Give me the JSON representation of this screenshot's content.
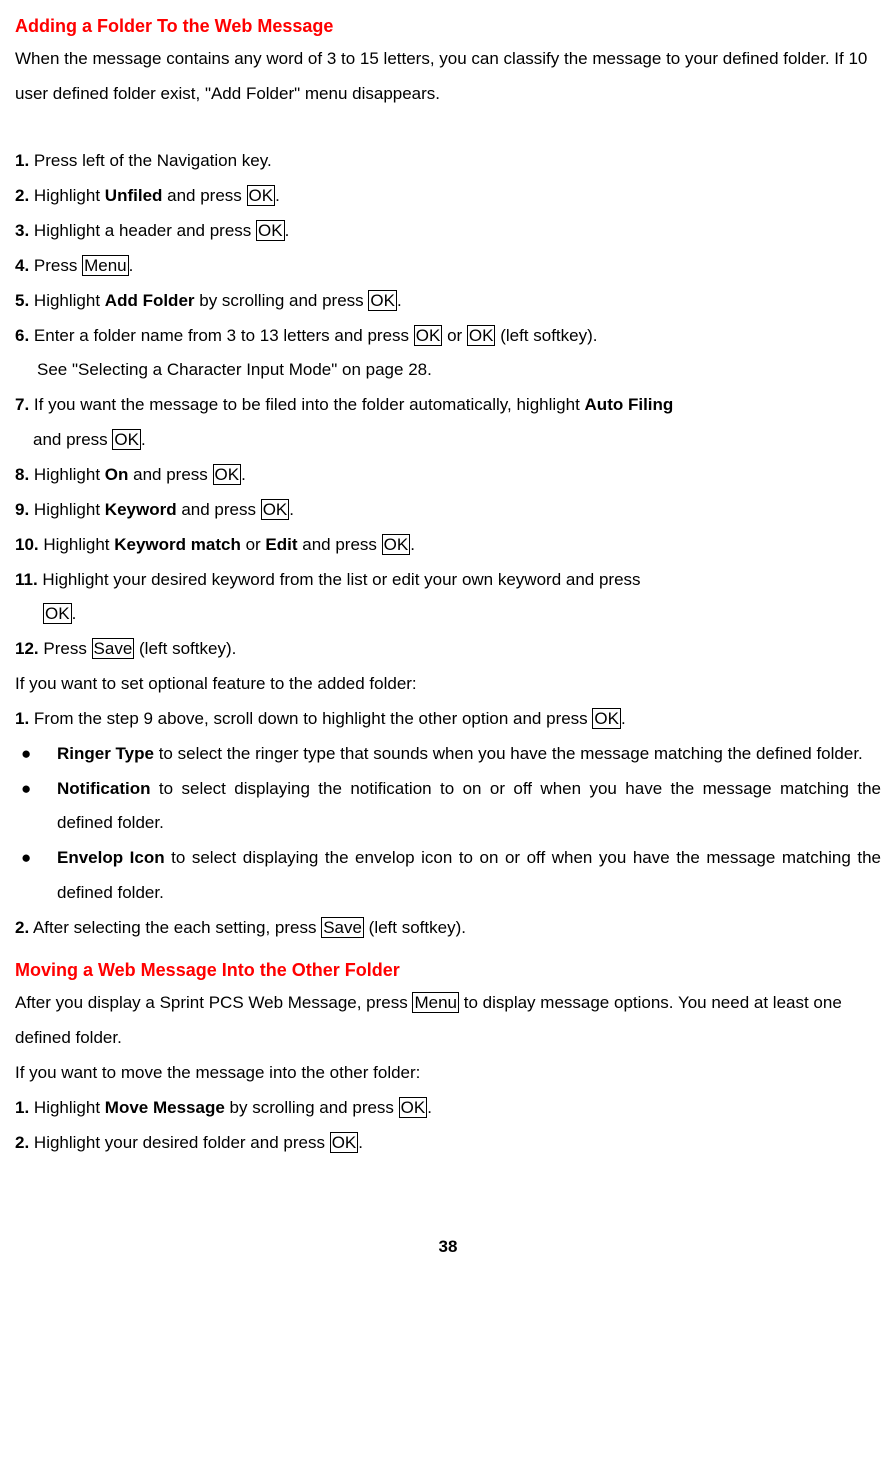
{
  "heading1": "Adding a Folder To the Web Message",
  "intro1": "When the message contains any word of 3 to 15 letters, you can classify the message to your defined folder. If 10 user defined folder exist, \"Add Folder\" menu disappears.",
  "steps1": {
    "s1_num": "1.",
    "s1_t1": " Press left of the Navigation key.",
    "s2_num": "2.",
    "s2_t1": " Highlight ",
    "s2_b1": "Unfiled",
    "s2_t2": " and press ",
    "s2_k1": "OK",
    "s2_t3": ".",
    "s3_num": "3.",
    "s3_t1": " Highlight a header and press ",
    "s3_k1": "OK",
    "s3_t2": ".",
    "s4_num": "4.",
    "s4_t1": " Press ",
    "s4_k1": "Menu",
    "s4_t2": ".",
    "s5_num": "5.",
    "s5_t1": " Highlight ",
    "s5_b1": "Add Folder",
    "s5_t2": " by scrolling and press ",
    "s5_k1": "OK",
    "s5_t3": ".",
    "s6_num": "6.",
    "s6_t1": " Enter a folder name from 3 to 13 letters and press ",
    "s6_k1": "OK",
    "s6_t2": " or ",
    "s6_k2": "OK",
    "s6_t3": " (left softkey).",
    "s6_sub": "See \"Selecting a Character Input Mode\" on page 28.",
    "s7_num": "7.",
    "s7_t1": " If you want the message to be filed into the folder automatically, highlight ",
    "s7_b1": "Auto Filing",
    "s7_line2_t1": "and press ",
    "s7_line2_k1": "OK",
    "s7_line2_t2": ".",
    "s8_num": "8.",
    "s8_t1": " Highlight ",
    "s8_b1": "On",
    "s8_t2": " and press ",
    "s8_k1": "OK",
    "s8_t3": ".",
    "s9_num": "9.",
    "s9_t1": " Highlight ",
    "s9_b1": "Keyword",
    "s9_t2": " and press ",
    "s9_k1": "OK",
    "s9_t3": ".",
    "s10_num": "10.",
    "s10_t1": " Highlight ",
    "s10_b1": "Keyword match",
    "s10_t2": " or ",
    "s10_b2": "Edit",
    "s10_t3": " and press ",
    "s10_k1": "OK",
    "s10_t4": ".",
    "s11_num": "11.",
    "s11_t1": " Highlight your desired keyword from the list or edit your own keyword and press",
    "s11_line2_k1": "OK",
    "s11_line2_t1": ".",
    "s12_num": "12.",
    "s12_t1": " Press ",
    "s12_k1": "Save",
    "s12_t2": " (left softkey)."
  },
  "optional_intro": "If you want to set optional feature to the added folder:",
  "opt1_num": "1.",
  "opt1_t1": " From the step 9 above, scroll down to highlight the other option and press ",
  "opt1_k1": "OK",
  "opt1_t2": ".",
  "bullet1_b": "Ringer Type",
  "bullet1_t": " to select the ringer type that sounds when you have the message matching the defined folder.",
  "bullet2_b": "Notification",
  "bullet2_t": " to select displaying the notification to on or off when you have the message matching the defined folder.",
  "bullet3_b": "Envelop Icon",
  "bullet3_t": " to select displaying the envelop icon to on or off when you have the message matching the defined folder.",
  "opt2_num": "2.",
  "opt2_t1": " After selecting the each setting, press ",
  "opt2_k1": "Save",
  "opt2_t2": " (left softkey).",
  "heading2": "Moving a Web Message Into the Other Folder",
  "h2_t1": "After you display a Sprint PCS Web Message, press ",
  "h2_k1": "Menu",
  "h2_t2": " to display message options. You need at least one defined folder.",
  "h2_sub": "If you want to move the message into the other folder:",
  "m1_num": "1.",
  "m1_t1": " Highlight ",
  "m1_b1": "Move Message",
  "m1_t2": " by scrolling and press ",
  "m1_k1": "OK",
  "m1_t3": ".",
  "m2_num": "2.",
  "m2_t1": " Highlight your desired folder and press ",
  "m2_k1": "OK",
  "m2_t2": ".",
  "page_number": "38"
}
